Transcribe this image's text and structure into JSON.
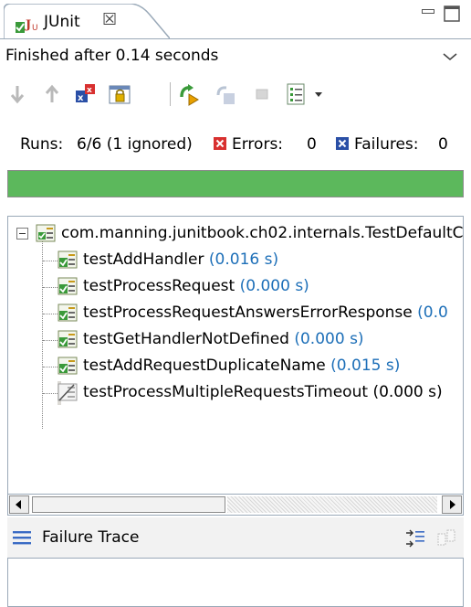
{
  "view": {
    "tab_title": "JUnit",
    "tab_close_symbol": "☒",
    "tab_icon": "junit-icon"
  },
  "status": {
    "text": "Finished after 0.14 seconds"
  },
  "toolbar": {
    "buttons": [
      "next-failure-icon",
      "previous-failure-icon",
      "show-failures-only-icon",
      "scroll-lock-icon",
      "rerun-test-icon",
      "rerun-failed-first-icon",
      "stop-icon",
      "test-run-history-icon",
      "history-dropdown-icon"
    ]
  },
  "counters": {
    "runs_label": "Runs:",
    "runs_value": "6/6 (1 ignored)",
    "errors_label": "Errors:",
    "errors_value": "0",
    "failures_label": "Failures:",
    "failures_value": "0"
  },
  "progress": {
    "fraction": 1.0,
    "color": "#5cb85c"
  },
  "tree": {
    "suite": "com.manning.junitbook.ch02.internals.TestDefaultC",
    "tests": [
      {
        "name": "testAddHandler",
        "time": "(0.016 s)",
        "state": "passed"
      },
      {
        "name": "testProcessRequest",
        "time": "(0.000 s)",
        "state": "passed"
      },
      {
        "name": "testProcessRequestAnswersErrorResponse",
        "time": "(0.0",
        "state": "passed"
      },
      {
        "name": "testGetHandlerNotDefined",
        "time": "(0.000 s)",
        "state": "passed"
      },
      {
        "name": "testAddRequestDuplicateName",
        "time": "(0.015 s)",
        "state": "passed"
      },
      {
        "name": "testProcessMultipleRequestsTimeout",
        "time": "(0.000 s)",
        "state": "ignored",
        "selected": true
      }
    ]
  },
  "trace": {
    "title": "Failure Trace"
  },
  "colors": {
    "time_text": "#1d6fb8",
    "selection": "#dcdad5",
    "error_red": "#d8302f",
    "failure_blue": "#2a4fa6"
  }
}
